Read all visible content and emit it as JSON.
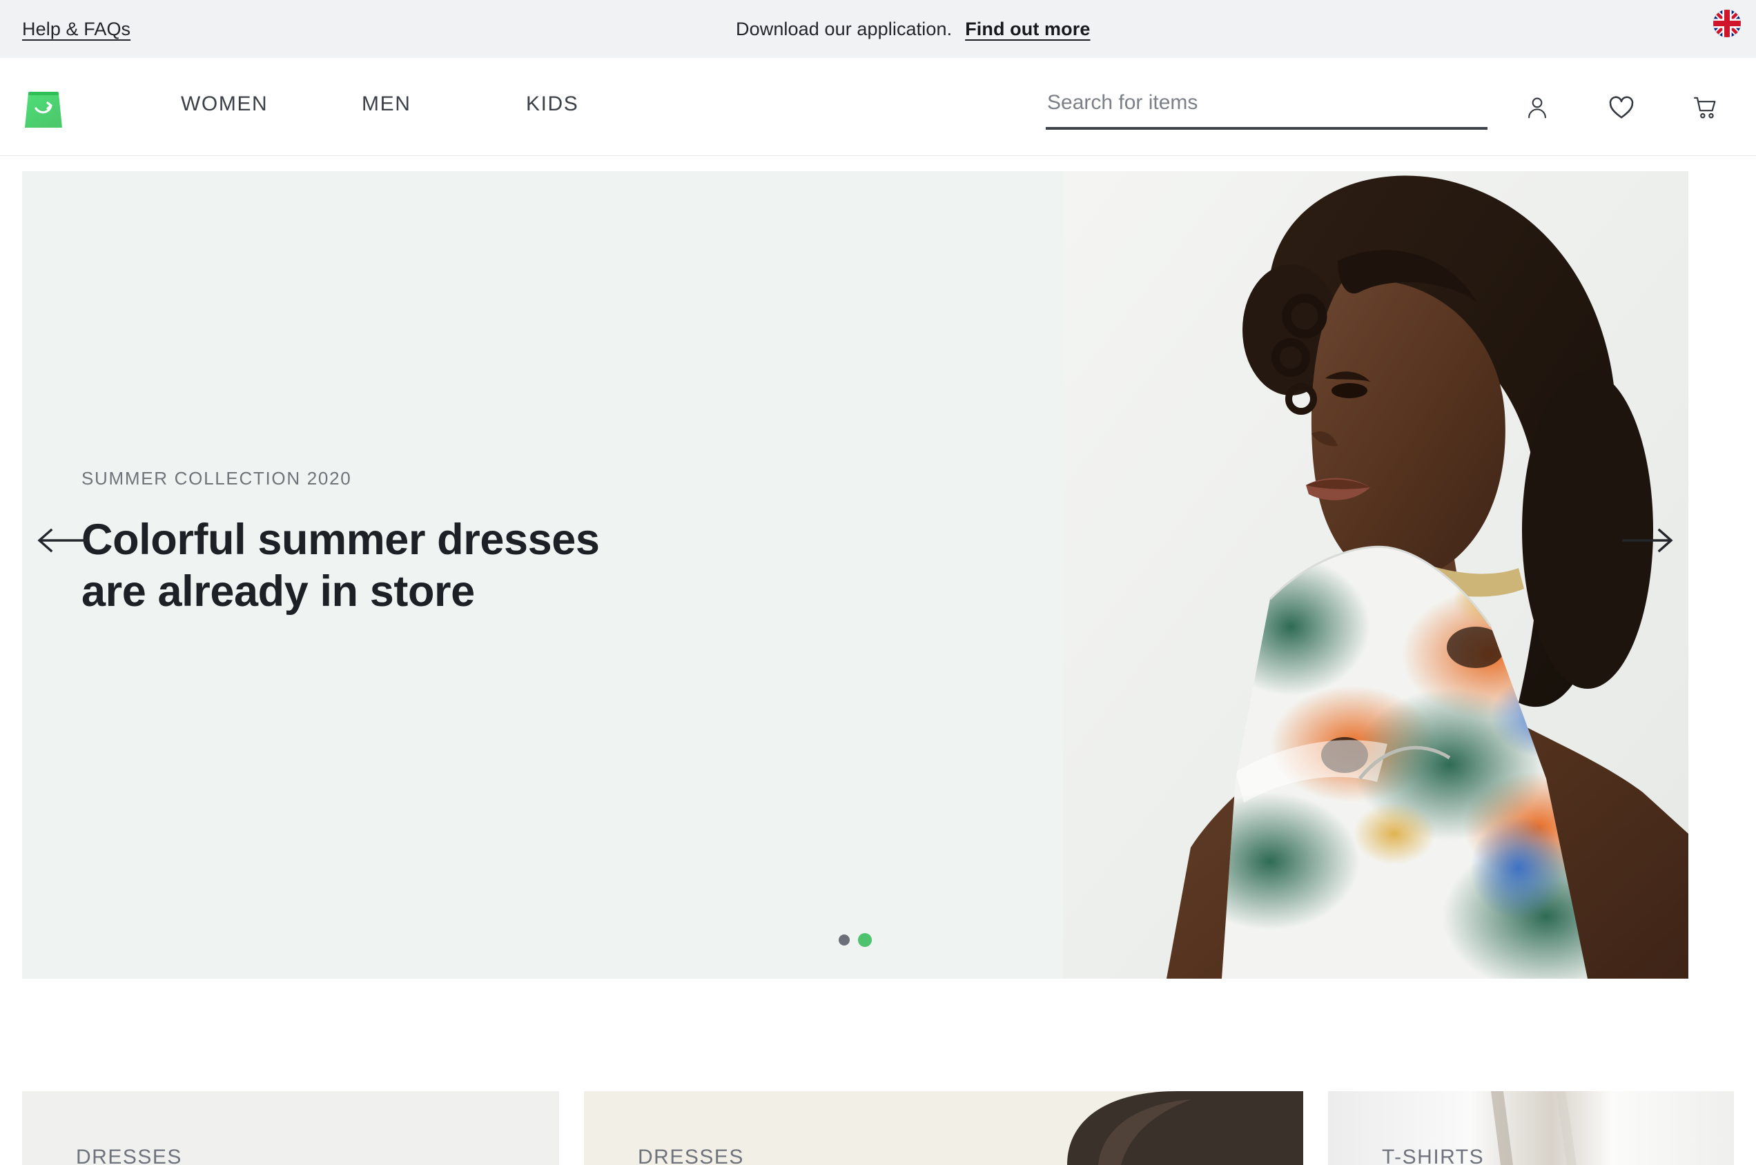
{
  "topbar": {
    "help_link": "Help & FAQs",
    "message": "Download our application.",
    "cta": "Find out more",
    "flag_icon": "uk-flag-icon"
  },
  "header": {
    "logo_icon": "shopping-bag-logo",
    "nav": [
      {
        "label": "WOMEN"
      },
      {
        "label": "MEN"
      },
      {
        "label": "KIDS"
      }
    ],
    "search": {
      "value": "",
      "placeholder": "Search for items"
    },
    "icons": [
      {
        "name": "account-icon"
      },
      {
        "name": "wishlist-heart-icon"
      },
      {
        "name": "shopping-cart-icon"
      }
    ]
  },
  "hero": {
    "eyebrow": "SUMMER COLLECTION 2020",
    "title_line1": "Colorful summer dresses",
    "title_line2": "are already in store",
    "prev_label": "Previous slide",
    "next_label": "Next slide",
    "background_color": "#eff3f2",
    "slides": [
      {
        "active": false,
        "color": "#6a6f7a"
      },
      {
        "active": true,
        "color": "#4fc26d"
      }
    ]
  },
  "categories": [
    {
      "label": "DRESSES",
      "background": "#f0f0ef"
    },
    {
      "label": "DRESSES",
      "background": "#f2efe6"
    },
    {
      "label": "T-SHIRTS",
      "background": "#f2f2f2"
    }
  ]
}
